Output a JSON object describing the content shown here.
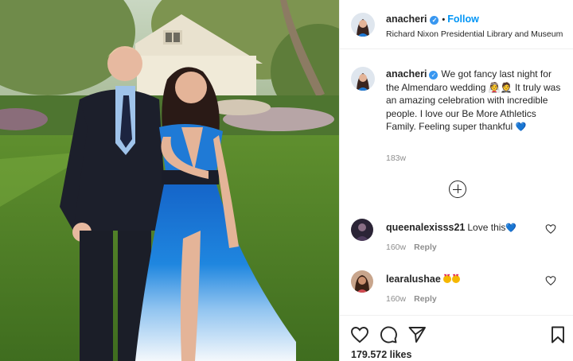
{
  "post": {
    "author": "anacheri",
    "verified": true,
    "follow_label": "Follow",
    "separator": "•",
    "location": "Richard Nixon Presidential Library and Museum"
  },
  "caption": {
    "username": "anacheri",
    "text": "We got fancy last night for the Almendaro wedding 👰🤵 It truly was an amazing celebration with incredible people. I love our Be More Athletics Family. Feeling super thankful",
    "trailing_emoji": "💙",
    "time": "183w"
  },
  "comments": [
    {
      "username": "queenalexisss21",
      "text": "Love this",
      "emoji": "💙",
      "time": "160w",
      "reply_label": "Reply"
    },
    {
      "username": "learalushae",
      "text": "",
      "emoji": "😍😍",
      "time": "160w",
      "reply_label": "Reply"
    }
  ],
  "actions": {
    "icons": [
      "heart-icon",
      "comment-icon",
      "share-icon",
      "bookmark-icon"
    ]
  },
  "likes_label": "179.572 likes",
  "colors": {
    "accent": "#0095f6",
    "verified": "#3897f0",
    "text": "#262626",
    "muted": "#8e8e8e",
    "border": "#efefef"
  }
}
